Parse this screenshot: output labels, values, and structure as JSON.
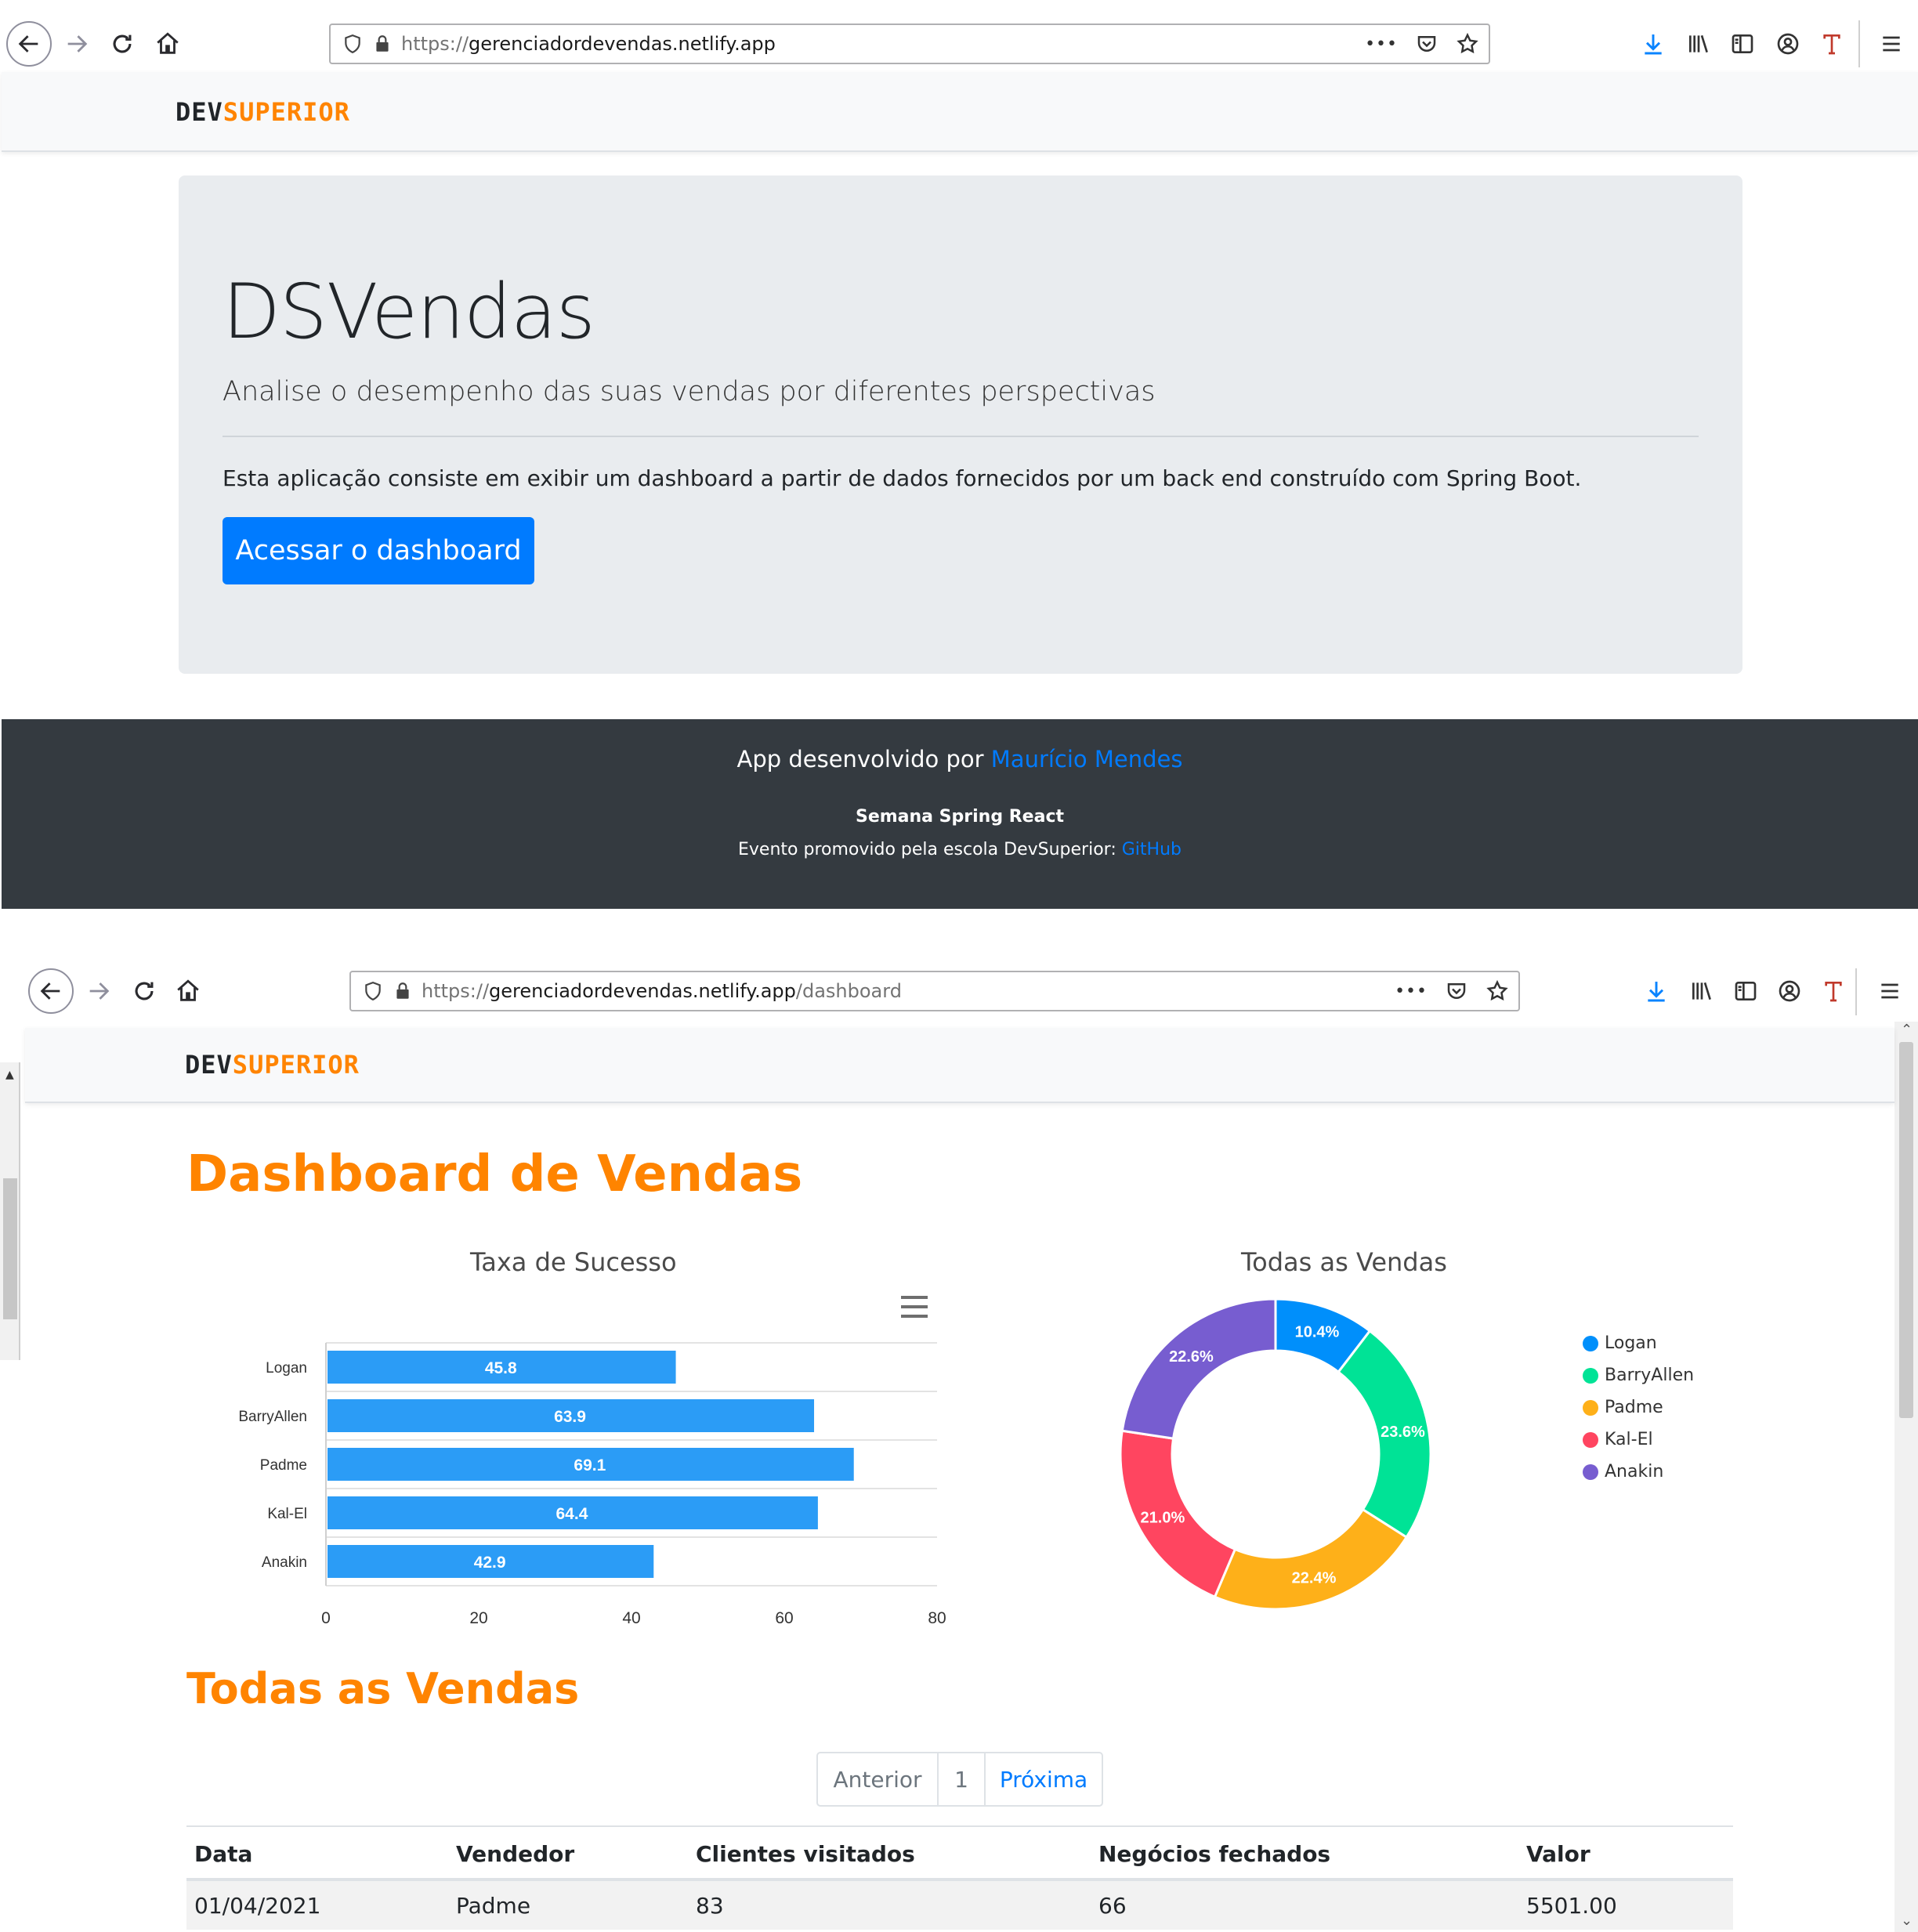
{
  "browser1": {
    "url_scheme": "https://",
    "url_host": "gerenciadordevendas.netlify.app",
    "url_path": "",
    "more_glyph": "•••"
  },
  "browser2": {
    "url_scheme": "https://",
    "url_host": "gerenciadordevendas.netlify.app",
    "url_path": "/dashboard",
    "more_glyph": "•••"
  },
  "brand": {
    "dev": "DEV",
    "superior": "SUPERIOR",
    "dev_color": "#212529",
    "superior_color": "#ff8400"
  },
  "home": {
    "title": "DSVendas",
    "lead": "Analise o desempenho das suas vendas por diferentes perspectivas",
    "description": "Esta aplicação consiste em exibir um dashboard a partir de dados fornecidos por um back end construído com Spring Boot.",
    "cta_label": "Acessar o dashboard"
  },
  "footer": {
    "credit_prefix": "App desenvolvido por ",
    "credit_author": "Maurício Mendes",
    "event_title": "Semana Spring React",
    "event_prefix": "Evento promovido pela escola DevSuperior: ",
    "event_link": "GitHub"
  },
  "dashboard": {
    "title": "Dashboard de Vendas",
    "bar_chart_title": "Taxa de Sucesso",
    "donut_chart_title": "Todas as Vendas",
    "menu_icon": "hamburger-icon",
    "sales_section_title": "Todas as Vendas",
    "pagination": {
      "prev": "Anterior",
      "current": "1",
      "next": "Próxima"
    },
    "table": {
      "headers": [
        "Data",
        "Vendedor",
        "Clientes visitados",
        "Negócios fechados",
        "Valor"
      ],
      "rows": [
        [
          "01/04/2021",
          "Padme",
          "83",
          "66",
          "5501.00"
        ]
      ]
    }
  },
  "chart_data": [
    {
      "type": "bar",
      "orientation": "horizontal",
      "title": "Taxa de Sucesso",
      "categories": [
        "Logan",
        "BarryAllen",
        "Padme",
        "Kal-El",
        "Anakin"
      ],
      "values": [
        45.8,
        63.9,
        69.1,
        64.4,
        42.9
      ],
      "xlim": [
        0,
        80
      ],
      "xticks": [
        "0",
        "20",
        "40",
        "60",
        "80"
      ],
      "color": "#2b9cf6",
      "data_labels": true,
      "grid": true
    },
    {
      "type": "pie",
      "variant": "donut",
      "title": "Todas as Vendas",
      "labels": [
        "Logan",
        "BarryAllen",
        "Padme",
        "Kal-El",
        "Anakin"
      ],
      "values": [
        10.4,
        23.6,
        22.4,
        21.0,
        22.6
      ],
      "data_labels": [
        "10.4%",
        "23.6%",
        "22.4%",
        "21.0%",
        "22.6%"
      ],
      "colors": [
        "#008ffb",
        "#00e396",
        "#feb019",
        "#ff4560",
        "#775dd0"
      ],
      "legend_position": "right"
    }
  ],
  "colors": {
    "accent": "#ff8400",
    "primary": "#007bff",
    "footer_bg": "#343a40",
    "jumbotron_bg": "#e9ecef"
  }
}
